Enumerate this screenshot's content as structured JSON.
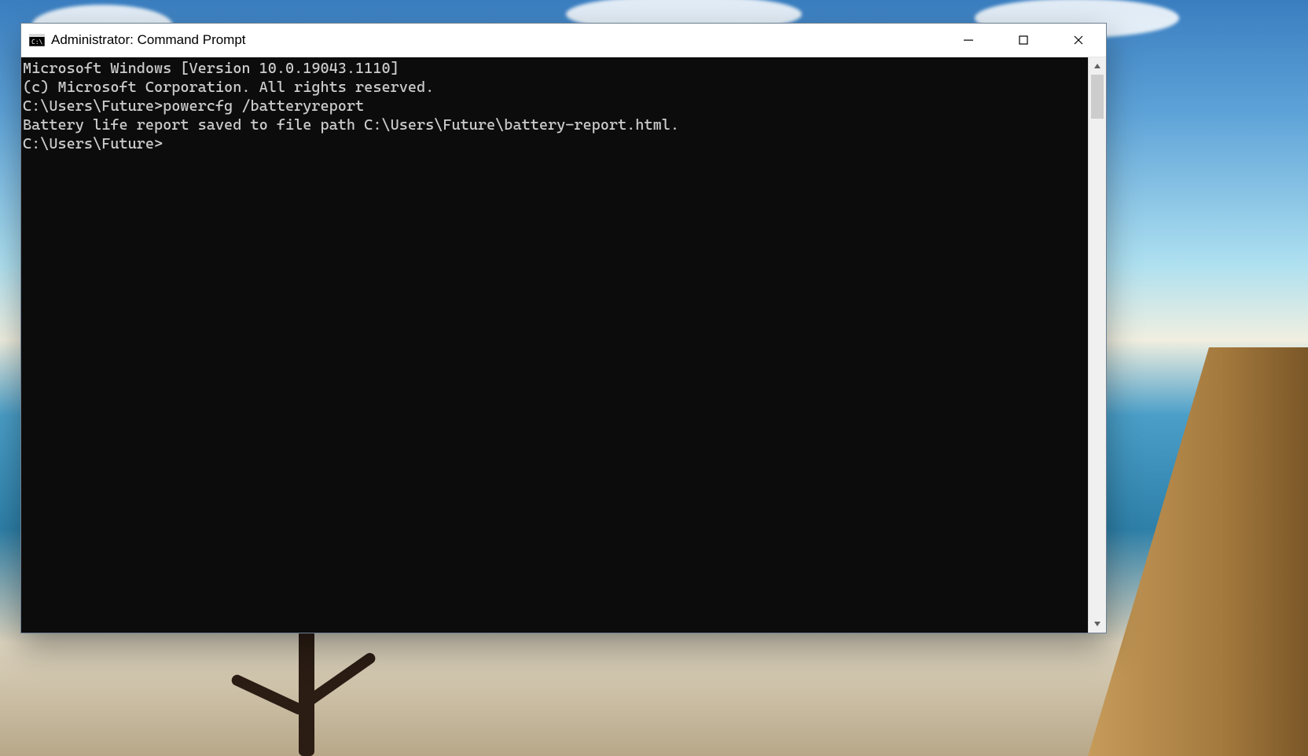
{
  "window": {
    "title": "Administrator: Command Prompt"
  },
  "terminal": {
    "lines": [
      "Microsoft Windows [Version 10.0.19043.1110]",
      "(c) Microsoft Corporation. All rights reserved.",
      "",
      "C:\\Users\\Future>powercfg /batteryreport",
      "Battery life report saved to file path C:\\Users\\Future\\battery-report.html.",
      "",
      "C:\\Users\\Future>"
    ]
  }
}
